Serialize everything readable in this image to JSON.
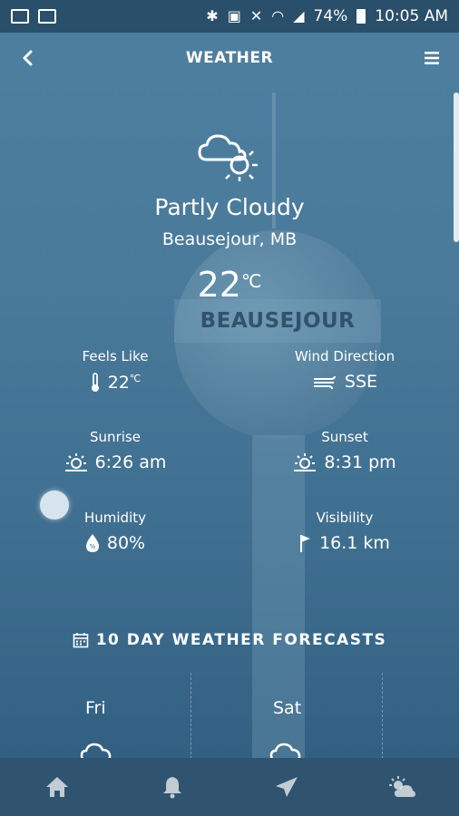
{
  "status_bar": {
    "battery": "74%",
    "time": "10:05 AM"
  },
  "app_bar": {
    "title": "WEATHER"
  },
  "background": {
    "tower_text": "BEAUSEJOUR"
  },
  "current": {
    "condition": "Partly Cloudy",
    "location": "Beausejour, MB",
    "temperature": "22",
    "temperature_unit": "℃"
  },
  "stats": {
    "feels_like": {
      "label": "Feels Like",
      "value": "22",
      "unit": "℃"
    },
    "wind_direction": {
      "label": "Wind Direction",
      "value": "SSE"
    },
    "sunrise": {
      "label": "Sunrise",
      "value": "6:26 am"
    },
    "sunset": {
      "label": "Sunset",
      "value": "8:31 pm"
    },
    "humidity": {
      "label": "Humidity",
      "value": "80%"
    },
    "visibility": {
      "label": "Visibility",
      "value": "16.1 km"
    }
  },
  "forecast": {
    "title": "10 DAY WEATHER FORECASTS",
    "days": [
      {
        "label": "Fri"
      },
      {
        "label": "Sat"
      }
    ]
  },
  "bottom_nav": [
    {
      "icon": "home-icon"
    },
    {
      "icon": "bell-icon"
    },
    {
      "icon": "send-icon"
    },
    {
      "icon": "sun-cloud-icon"
    }
  ]
}
